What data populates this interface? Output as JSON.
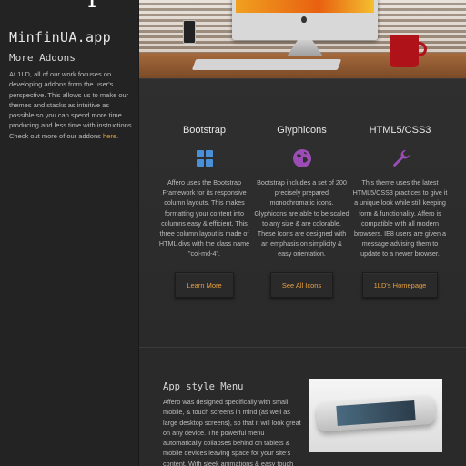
{
  "sidebar": {
    "site_title": "MinfinUA.app",
    "heading": "More Addons",
    "text": "At 1LD, all of our work focuses on developing addons from the user's perspective. This allows us to make our themes and stacks as intuitive as possible so you can spend more time producing and less time with instructions. Check out more of our addons ",
    "link_label": "here",
    "link_suffix": "."
  },
  "features": [
    {
      "title": "Bootstrap",
      "icon": "grid-icon",
      "text": "Affero uses the Bootstrap Framework for its responsive column layouts. This makes formatting your content into columns easy & efficient. This three column layout is made of HTML divs with the class name \"col-md-4\".",
      "button": "Learn More"
    },
    {
      "title": "Glyphicons",
      "icon": "globe-icon",
      "text": "Bootstrap includes a set of 200 precisely prepared monochromatic icons. Glyphicons are able to be scaled to any size & are colorable. These Icons are designed with an emphasis on simplicity & easy orientation.",
      "button": "See All Icons"
    },
    {
      "title": "HTML5/CSS3",
      "icon": "wrench-icon",
      "text": "This theme uses the latest HTML5/CSS3 practices to give it a unique look while still keeping form & functionality. Affero is compatible with all modern browsers. IE8 users are given a message advising them to update to a newer browser.",
      "button": "1LD's Homepage"
    }
  ],
  "app_section": {
    "title": "App style Menu",
    "text": "Affero was designed specifically with small, mobile, & touch screens in mind (as well as large desktop screens), so that it will look great on any device. The powerful menu automatically collapses behind on tablets & mobile devices leaving space for your site's content. With sleek animations & easy touch"
  },
  "colors": {
    "accent": "#e8a040",
    "icon_blue": "#4a90d9",
    "icon_purple": "#9b4db5",
    "background": "#262626"
  }
}
